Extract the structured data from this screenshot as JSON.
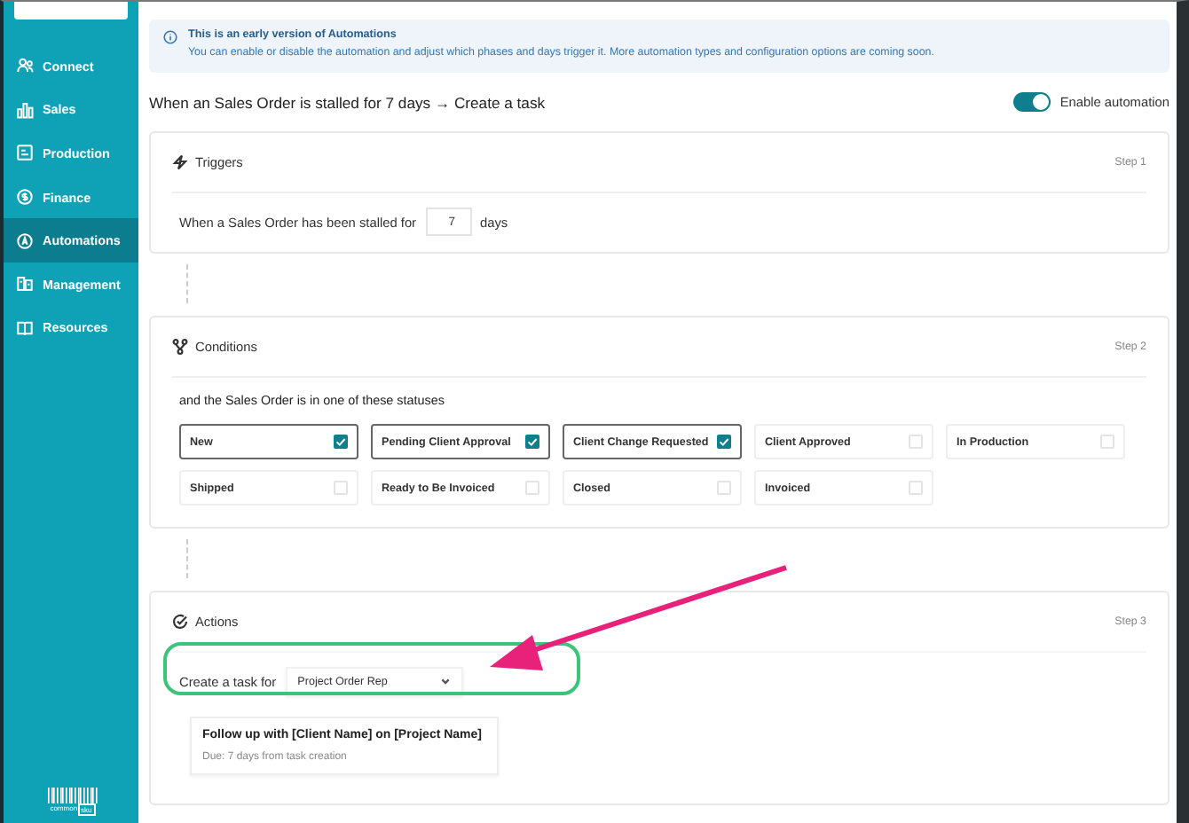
{
  "sidebar": {
    "items": [
      {
        "label": "Connect",
        "selected": false
      },
      {
        "label": "Sales",
        "selected": false
      },
      {
        "label": "Production",
        "selected": false
      },
      {
        "label": "Finance",
        "selected": false
      },
      {
        "label": "Automations",
        "selected": true
      },
      {
        "label": "Management",
        "selected": false
      },
      {
        "label": "Resources",
        "selected": false
      }
    ],
    "logo": {
      "word": "common",
      "tag": "sku"
    }
  },
  "banner": {
    "title": "This is an early version of Automations",
    "message": "You can enable or disable the automation and adjust which phases and days trigger it. More automation types and configuration options are coming soon."
  },
  "heading": "When an Sales Order is stalled for 7 days → Create a task",
  "toggle": {
    "label": "Enable automation",
    "on": true
  },
  "triggers": {
    "title": "Triggers",
    "step": "Step 1",
    "before": "When a Sales Order has been stalled for",
    "value": "7",
    "after": "days"
  },
  "conditions": {
    "title": "Conditions",
    "step": "Step 2",
    "prompt": "and the Sales Order is in one of these statuses",
    "statuses": [
      {
        "label": "New",
        "checked": true
      },
      {
        "label": "Pending Client Approval",
        "checked": true
      },
      {
        "label": "Client Change Requested",
        "checked": true
      },
      {
        "label": "Client Approved",
        "checked": false
      },
      {
        "label": "In Production",
        "checked": false
      },
      {
        "label": "Shipped",
        "checked": false
      },
      {
        "label": "Ready to Be Invoiced",
        "checked": false
      },
      {
        "label": "Closed",
        "checked": false
      },
      {
        "label": "Invoiced",
        "checked": false
      }
    ]
  },
  "actions": {
    "title": "Actions",
    "step": "Step 3",
    "label": "Create a task for",
    "assignee": "Project Order Rep",
    "task": {
      "title": "Follow up with [Client Name] on [Project Name]",
      "due": "Due: 7 days from task creation"
    }
  }
}
